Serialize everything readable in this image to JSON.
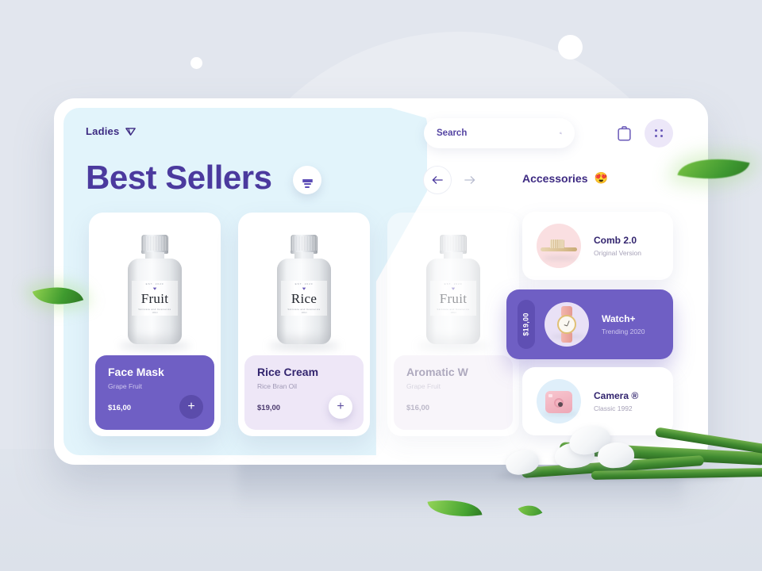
{
  "header": {
    "brand": "Ladies",
    "brand_icon": "diamond-icon",
    "page_title": "Best Sellers",
    "filter_icon": "filter-icon",
    "bag_icon": "clipboard-bag-icon",
    "grid_icon": "grid-dots-icon"
  },
  "search": {
    "placeholder": "Search",
    "value": "",
    "icon": "search-icon"
  },
  "carousel": {
    "prev_icon": "arrow-left-icon",
    "next_icon": "arrow-right-icon"
  },
  "accessories_section": {
    "title": "Accessories",
    "emoji": "😍"
  },
  "products": [
    {
      "name": "Face Mask",
      "subtitle": "Grape Fruit",
      "price": "$16,00",
      "bottle_label": "Fruit",
      "label_top": "EST.  2020",
      "label_sub": "Skincare  and  Cosmetics",
      "label_sub2": "100ml",
      "add_icon": "plus-icon",
      "theme": "purple"
    },
    {
      "name": "Rice Cream",
      "subtitle": "Rice Bran Oil",
      "price": "$19,00",
      "bottle_label": "Rice",
      "label_top": "EST.  2020",
      "label_sub": "Skincare  and  Cosmetics",
      "label_sub2": "100ml",
      "add_icon": "plus-icon",
      "theme": "lilac"
    },
    {
      "name": "Aromatic W",
      "subtitle": "Grape Fruit",
      "price": "$16,00",
      "bottle_label": "Fruit",
      "label_top": "EST.  2020",
      "label_sub": "Skincare  and  Cosmetics",
      "label_sub2": "100ml",
      "add_icon": "plus-icon",
      "theme": "faded"
    }
  ],
  "accessories": [
    {
      "name": "Comb 2.0",
      "subtitle": "Original Version",
      "thumb": "hair-brush-icon",
      "price": ""
    },
    {
      "name": "Watch+",
      "subtitle": "Trending 2020",
      "thumb": "wristwatch-icon",
      "price": "$19,00"
    },
    {
      "name": "Camera ®",
      "subtitle": "Classic 1992",
      "thumb": "instant-camera-icon",
      "price": ""
    }
  ],
  "colors": {
    "background": "#e2e6ee",
    "panel_blue": "#e2f4fb",
    "accent_purple": "#6f5fc4",
    "title_purple": "#4b3a9e",
    "dark_purple": "#32246e",
    "lilac": "#eee7f7"
  }
}
